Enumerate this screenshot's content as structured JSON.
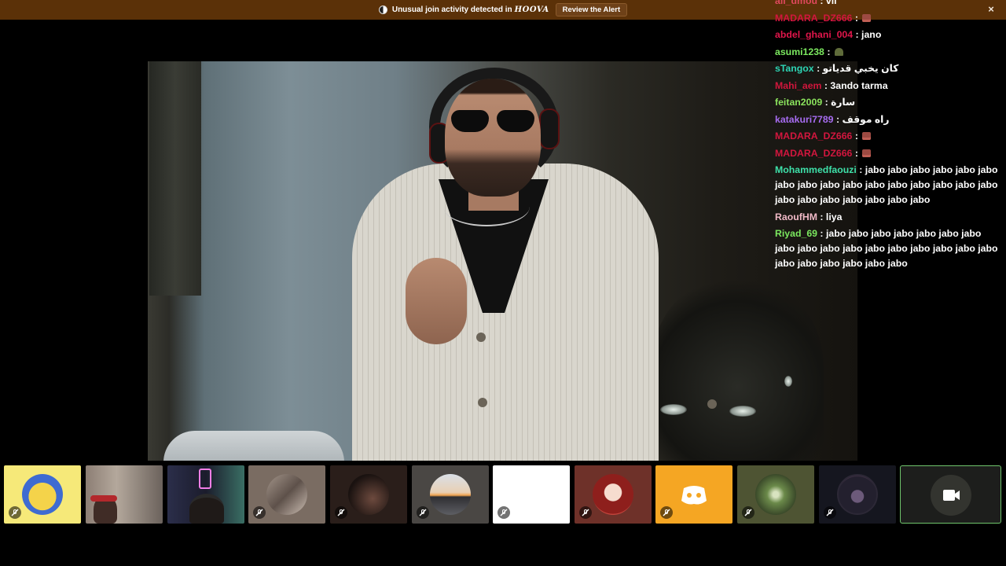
{
  "alert": {
    "message": "Unusual join activity detected in",
    "server": "HOOVA",
    "action": "Review the Alert",
    "close": "×"
  },
  "chat": {
    "messages": [
      {
        "user": "ali_dmou",
        "text": "vii",
        "color": "#e0485d"
      },
      {
        "user": "MADARA_DZ666",
        "text": "",
        "emoji": "red-face-emoji",
        "color": "#d2163e"
      },
      {
        "user": "abdel_ghani_004",
        "text": "jano",
        "color": "#e0164b"
      },
      {
        "user": "asumi1238",
        "text": "",
        "emoji": "army-helmet-emoji",
        "color": "#7be85f"
      },
      {
        "user": "sTangox",
        "text": "كان يخبي قدياتو",
        "color": "#2dd4b4"
      },
      {
        "user": "Mahi_aem",
        "text": "3ando tarma",
        "color": "#d0163c"
      },
      {
        "user": "feitan2009",
        "text": "سارة",
        "color": "#8be35d"
      },
      {
        "user": "katakuri7789",
        "text": "راه موقف",
        "color": "#a66cf0"
      },
      {
        "user": "MADARA_DZ666",
        "text": "",
        "emoji": "red-face-emoji",
        "color": "#d2163e"
      },
      {
        "user": "MADARA_DZ666",
        "text": "",
        "emoji": "red-face-emoji",
        "color": "#d2163e"
      },
      {
        "user": "Mohammedfaouzi",
        "text": "jabo jabo jabo jabo jabo jabo jabo jabo jabo jabo jabo jabo jabo jabo jabo jabo jabo jabo jabo jabo jabo jabo jabo",
        "color": "#3ee0a9"
      },
      {
        "user": "RaoufHM",
        "text": "liya",
        "color": "#f0b9c6"
      },
      {
        "user": "Riyad_69",
        "text": "jabo jabo jabo jabo jabo jabo jabo jabo jabo jabo jabo jabo jabo jabo jabo jabo jabo jabo jabo jabo jabo jabo jabo",
        "color": "#7be85f"
      }
    ]
  },
  "colors": {
    "alert_bg": "#5b3108",
    "active_tile_border": "#6fc46c",
    "discord_orange": "#f5a623"
  },
  "participants": [
    {
      "name": "pikachu-avatar-tile",
      "icon": "muted-mic-icon"
    },
    {
      "name": "camera-feed-tile-1",
      "icon": ""
    },
    {
      "name": "camera-feed-tile-2",
      "icon": ""
    },
    {
      "name": "avatar-tile-3",
      "icon": "muted-mic-icon"
    },
    {
      "name": "avatar-tile-4",
      "icon": "muted-mic-icon"
    },
    {
      "name": "sunset-avatar-tile",
      "icon": "muted-mic-icon"
    },
    {
      "name": "blank-avatar-tile",
      "icon": "muted-mic-icon"
    },
    {
      "name": "anime-girl-avatar-tile",
      "icon": "muted-mic-icon"
    },
    {
      "name": "discord-default-avatar-tile",
      "icon": "muted-mic-icon"
    },
    {
      "name": "tunnel-avatar-tile",
      "icon": "muted-mic-icon"
    },
    {
      "name": "dark-girl-avatar-tile",
      "icon": "muted-mic-icon"
    },
    {
      "name": "video-camera-tile",
      "icon": "video-camera-icon"
    }
  ]
}
